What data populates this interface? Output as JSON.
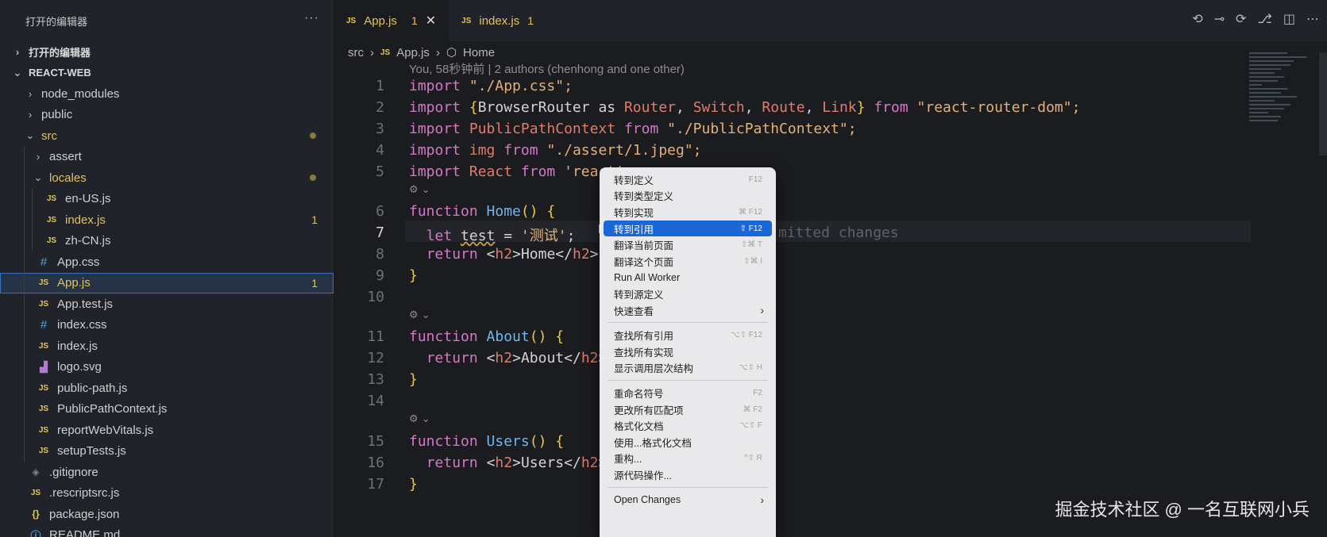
{
  "sidebar": {
    "title": "打开的编辑器",
    "more": "···",
    "open_editors_section": "打开的编辑器",
    "project_section": "REACT-WEB",
    "items": [
      {
        "label": "node_modules",
        "type": "folder",
        "expanded": false,
        "depth": 1
      },
      {
        "label": "public",
        "type": "folder",
        "expanded": false,
        "depth": 1
      },
      {
        "label": "src",
        "type": "folder",
        "expanded": true,
        "depth": 1,
        "modified": true
      },
      {
        "label": "assert",
        "type": "folder",
        "expanded": false,
        "depth": 2
      },
      {
        "label": "locales",
        "type": "folder",
        "expanded": true,
        "depth": 2,
        "modified": true
      },
      {
        "label": "en-US.js",
        "type": "js",
        "depth": 3
      },
      {
        "label": "index.js",
        "type": "js",
        "depth": 3,
        "modified": true,
        "badge": "1"
      },
      {
        "label": "zh-CN.js",
        "type": "js",
        "depth": 3
      },
      {
        "label": "App.css",
        "type": "css",
        "depth": 2
      },
      {
        "label": "App.js",
        "type": "js",
        "depth": 2,
        "modified": true,
        "badge": "1",
        "selected": true
      },
      {
        "label": "App.test.js",
        "type": "js",
        "depth": 2
      },
      {
        "label": "index.css",
        "type": "css",
        "depth": 2
      },
      {
        "label": "index.js",
        "type": "js",
        "depth": 2
      },
      {
        "label": "logo.svg",
        "type": "svg",
        "depth": 2
      },
      {
        "label": "public-path.js",
        "type": "js",
        "depth": 2
      },
      {
        "label": "PublicPathContext.js",
        "type": "js",
        "depth": 2
      },
      {
        "label": "reportWebVitals.js",
        "type": "js",
        "depth": 2
      },
      {
        "label": "setupTests.js",
        "type": "js",
        "depth": 2
      },
      {
        "label": ".gitignore",
        "type": "git",
        "depth": 1
      },
      {
        "label": ".rescriptsrc.js",
        "type": "js",
        "depth": 1
      },
      {
        "label": "package.json",
        "type": "json",
        "depth": 1
      },
      {
        "label": "README.md",
        "type": "md",
        "depth": 1
      }
    ]
  },
  "tabs": [
    {
      "label": "App.js",
      "problems": "1",
      "active": true,
      "close": "✕"
    },
    {
      "label": "index.js",
      "problems": "1",
      "active": false
    }
  ],
  "breadcrumb": {
    "folder": "src",
    "file": "App.js",
    "symbol": "Home"
  },
  "blame": "You, 58秒钟前 | 2 authors (chenhong and one other)",
  "inline_hint": "mitted changes",
  "code": {
    "lines": [
      "1",
      "2",
      "3",
      "4",
      "5",
      "6",
      "7",
      "8",
      "9",
      "10",
      "11",
      "12",
      "13",
      "14",
      "15",
      "16",
      "17"
    ],
    "current_line": "7",
    "l1": {
      "k": "import",
      "s": "\"./App.css\";"
    },
    "l2": {
      "k": "import",
      "open": "{",
      "a": "BrowserRouter",
      "as": " as ",
      "r": "Router",
      "c1": ", ",
      "sw": "Switch",
      "c2": ", ",
      "ro": "Route",
      "c3": ", ",
      "li": "Link",
      "close": "}",
      "from": "from",
      "s": "\"react-router-dom\";"
    },
    "l3": {
      "k": "import",
      "id": "PublicPathContext",
      "from": "from",
      "s": "\"./PublicPathContext\";"
    },
    "l4": {
      "k": "import",
      "id": "img",
      "from": "from",
      "s": "\"./assert/1.jpeg\";"
    },
    "l5": {
      "k": "import",
      "id": "React",
      "from": "from",
      "s": "'react'"
    },
    "l6": {
      "k": "function",
      "fn": "Home",
      "par": "()",
      "br": "{"
    },
    "l7": {
      "k": "let",
      "id": "test",
      "eq": " = ",
      "s": "'测试'",
      "semi": ";"
    },
    "l8": {
      "k": "return",
      "lt": "<",
      "tag": "h2",
      "gt": ">",
      "txt": "Home",
      "lt2": "</",
      "tag2": "h2",
      "end": ">;"
    },
    "l9": {
      "br": "}"
    },
    "l11": {
      "k": "function",
      "fn": "About",
      "par": "()",
      "br": "{"
    },
    "l12": {
      "k": "return",
      "lt": "<",
      "tag": "h2",
      "gt": ">",
      "txt": "About",
      "lt2": "</",
      "tag2": "h2",
      "end": ">;"
    },
    "l13": {
      "br": "}"
    },
    "l15": {
      "k": "function",
      "fn": "Users",
      "par": "()",
      "br": "{"
    },
    "l16": {
      "k": "return",
      "lt": "<",
      "tag": "h2",
      "gt": ">",
      "txt": "Users",
      "lt2": "</",
      "tag2": "h2",
      "end": ">;"
    },
    "l17": {
      "br": "}"
    }
  },
  "context_menu": {
    "items": [
      {
        "label": "转到定义",
        "shortcut": "F12"
      },
      {
        "label": "转到类型定义",
        "shortcut": ""
      },
      {
        "label": "转到实现",
        "shortcut": "⌘ F12"
      },
      {
        "label": "转到引用",
        "shortcut": "⇧ F12",
        "highlighted": true
      },
      {
        "label": "翻译当前页面",
        "shortcut": "⇧⌘ T"
      },
      {
        "label": "翻译这个页面",
        "shortcut": "⇧⌘ I"
      },
      {
        "label": "Run All Worker",
        "shortcut": ""
      },
      {
        "label": "转到源定义",
        "shortcut": ""
      },
      {
        "label": "快速查看",
        "shortcut": "",
        "submenu": true
      },
      {
        "separator": true
      },
      {
        "label": "查找所有引用",
        "shortcut": "⌥⇧ F12"
      },
      {
        "label": "查找所有实现",
        "shortcut": ""
      },
      {
        "label": "显示调用层次结构",
        "shortcut": "⌥⇧ H"
      },
      {
        "separator": true
      },
      {
        "label": "重命名符号",
        "shortcut": "F2"
      },
      {
        "label": "更改所有匹配项",
        "shortcut": "⌘ F2"
      },
      {
        "label": "格式化文档",
        "shortcut": "⌥⇧ F"
      },
      {
        "label": "使用...格式化文档",
        "shortcut": ""
      },
      {
        "label": "重构...",
        "shortcut": "^⇧ R"
      },
      {
        "label": "源代码操作...",
        "shortcut": ""
      },
      {
        "separator": true
      },
      {
        "label": "Open Changes",
        "shortcut": "",
        "submenu": true
      }
    ]
  },
  "watermark": "掘金技术社区 @ 一名互联网小兵"
}
